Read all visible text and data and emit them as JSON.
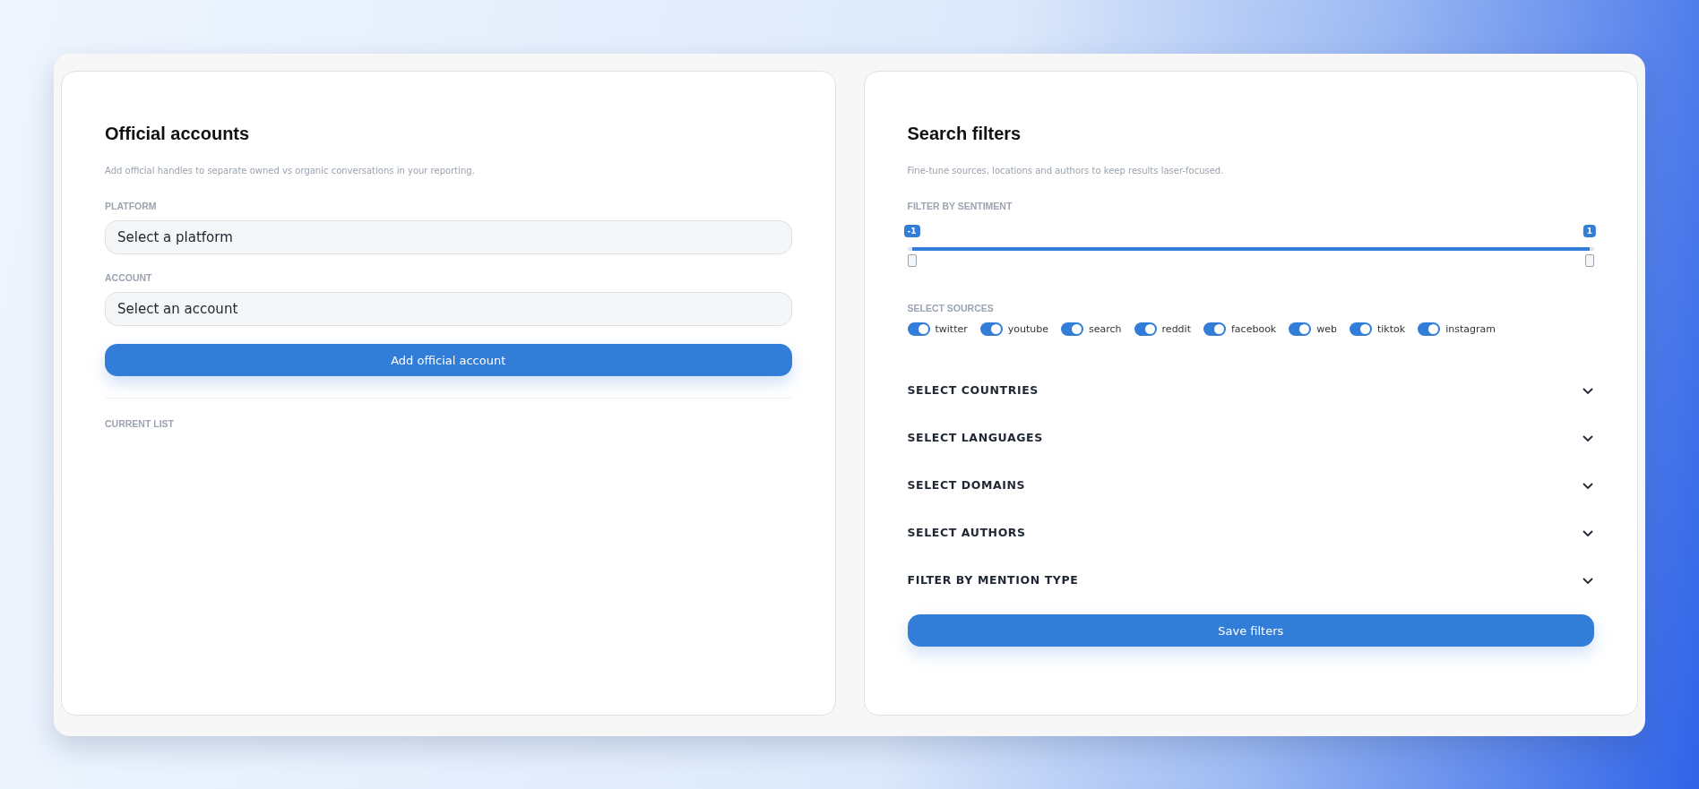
{
  "official_accounts": {
    "title": "Official accounts",
    "description": "Add official handles to separate owned vs organic conversations in your reporting.",
    "fields": [
      {
        "label": "PLATFORM",
        "placeholder": "Select a platform"
      },
      {
        "label": "ACCOUNT",
        "placeholder": "Select an account"
      }
    ],
    "add_button": "Add official account",
    "current_list_label": "CURRENT LIST"
  },
  "search_filters": {
    "title": "Search filters",
    "description": "Fine-tune sources, locations and authors to keep results laser-focused.",
    "sentiment": {
      "label": "FILTER BY SENTIMENT",
      "handles": [
        {
          "value": "-1",
          "level": 0
        },
        {
          "value": "1",
          "level": 1
        }
      ]
    },
    "sources_label": "SELECT SOURCES",
    "sources": [
      {
        "name": "twitter",
        "on": true
      },
      {
        "name": "youtube",
        "on": true
      },
      {
        "name": "search",
        "on": true
      },
      {
        "name": "reddit",
        "on": true
      },
      {
        "name": "facebook",
        "on": true
      },
      {
        "name": "web",
        "on": true
      },
      {
        "name": "tiktok",
        "on": true
      },
      {
        "name": "instagram",
        "on": true
      }
    ],
    "sections": [
      {
        "title": "SELECT COUNTRIES",
        "expanded": false
      },
      {
        "title": "SELECT LANGUAGES",
        "expanded": false
      },
      {
        "title": "SELECT DOMAINS",
        "expanded": false
      },
      {
        "title": "SELECT AUTHORS",
        "expanded": false
      },
      {
        "title": "FILTER BY MENTION TYPE",
        "expanded": false
      }
    ],
    "save_button": "Save filters"
  }
}
